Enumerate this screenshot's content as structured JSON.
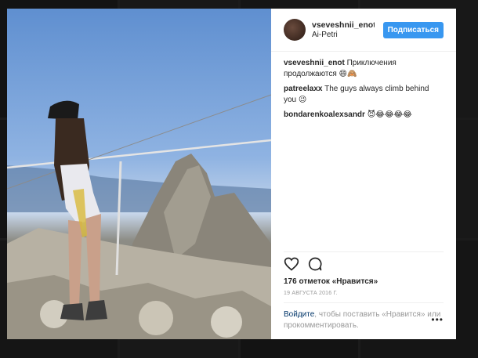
{
  "post": {
    "username": "vseveshnii_enot",
    "location": "Ai-Petri",
    "follow_label": "Подписаться",
    "comments": [
      {
        "user": "vseveshnii_enot",
        "text": "Приключения продолжаются 😄🙈"
      },
      {
        "user": "patreelaxx",
        "text": "The guys always climb behind you 😉"
      },
      {
        "user": "bondarenkoalexsandr",
        "text": "😈😂😂😂😂"
      }
    ],
    "likes": "176 отметок «Нравится»",
    "date": "19 АВГУСТА 2016 Г.",
    "login_link": "Войдите",
    "login_rest": ", чтобы поставить «Нравится» или прокомментировать.",
    "more": "•••"
  },
  "icons": {
    "like": "heart-icon",
    "comment": "comment-icon",
    "more": "more-icon"
  },
  "colors": {
    "accent": "#3897f0",
    "text": "#262626",
    "muted": "#999999"
  }
}
